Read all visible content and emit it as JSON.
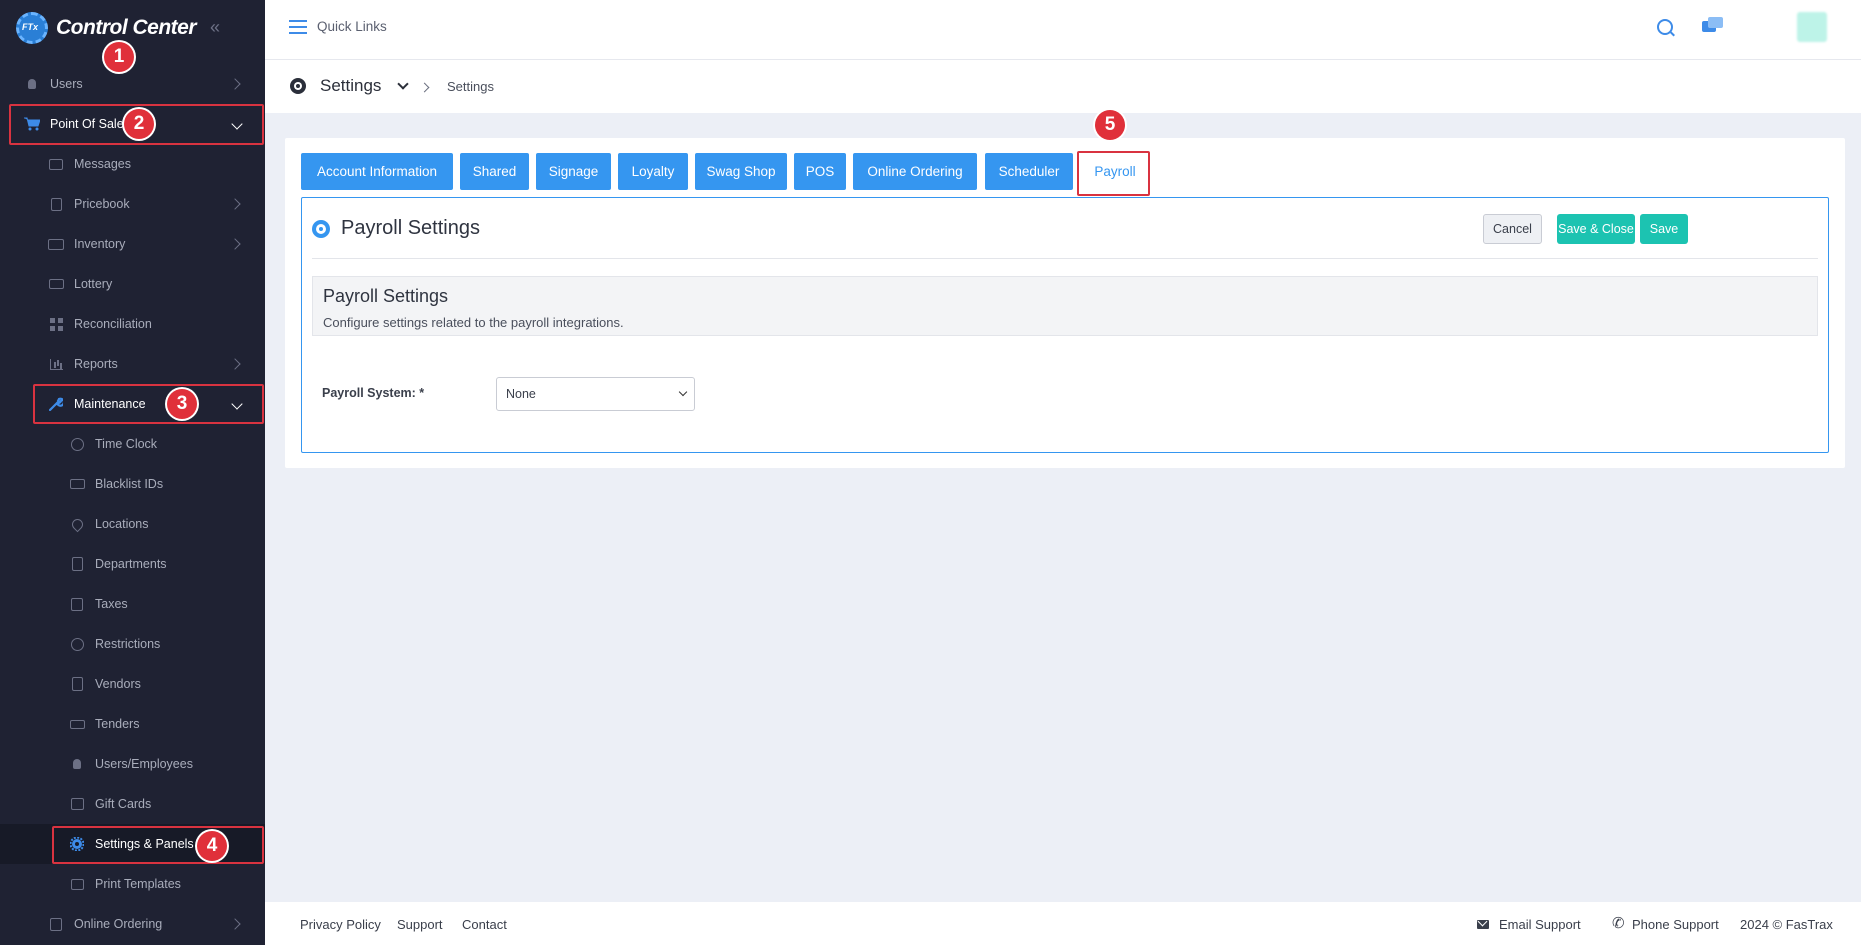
{
  "app": {
    "title": "Control Center",
    "logo_mark": "FTx"
  },
  "sidebar": {
    "items": {
      "users": "Users",
      "point_of_sale": "Point Of Sale",
      "messages": "Messages",
      "pricebook": "Pricebook",
      "inventory": "Inventory",
      "lottery": "Lottery",
      "reconciliation": "Reconciliation",
      "reports": "Reports",
      "maintenance": "Maintenance",
      "time_clock": "Time Clock",
      "blacklist_ids": "Blacklist IDs",
      "locations": "Locations",
      "departments": "Departments",
      "taxes": "Taxes",
      "restrictions": "Restrictions",
      "vendors": "Vendors",
      "tenders": "Tenders",
      "users_employees": "Users/Employees",
      "gift_cards": "Gift Cards",
      "settings_panels": "Settings & Panels",
      "print_templates": "Print Templates",
      "online_ordering": "Online Ordering"
    }
  },
  "annotations": [
    "1",
    "2",
    "3",
    "4",
    "5"
  ],
  "topbar": {
    "quick_links": "Quick Links"
  },
  "breadcrumb": {
    "title": "Settings",
    "current": "Settings"
  },
  "tabs": [
    "Account Information",
    "Shared",
    "Signage",
    "Loyalty",
    "Swag Shop",
    "POS",
    "Online Ordering",
    "Scheduler",
    "Payroll"
  ],
  "active_tab": "Payroll",
  "panel": {
    "title": "Payroll Settings",
    "cancel": "Cancel",
    "save_close": "Save & Close",
    "save": "Save",
    "info_title": "Payroll Settings",
    "info_desc": "Configure settings related to the payroll integrations.",
    "field_label": "Payroll System: *",
    "field_value": "None"
  },
  "footer": {
    "privacy": "Privacy Policy",
    "support": "Support",
    "contact": "Contact",
    "email_support": "Email Support",
    "phone_support": "Phone Support",
    "copyright": "2024 © FasTrax"
  },
  "colors": {
    "sidebar_bg": "#1f2233",
    "accent_blue": "#3596f0",
    "accent_teal": "#1cc3b1",
    "annotation_red": "#e0303a"
  }
}
